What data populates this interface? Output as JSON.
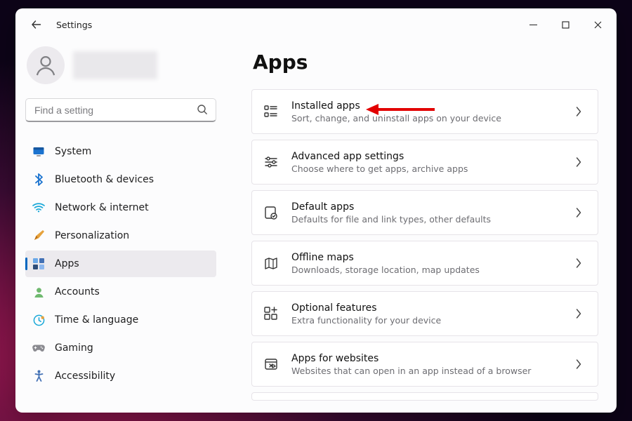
{
  "window": {
    "title": "Settings"
  },
  "search": {
    "placeholder": "Find a setting"
  },
  "nav": {
    "items": [
      {
        "label": "System"
      },
      {
        "label": "Bluetooth & devices"
      },
      {
        "label": "Network & internet"
      },
      {
        "label": "Personalization"
      },
      {
        "label": "Apps"
      },
      {
        "label": "Accounts"
      },
      {
        "label": "Time & language"
      },
      {
        "label": "Gaming"
      },
      {
        "label": "Accessibility"
      }
    ]
  },
  "page": {
    "title": "Apps",
    "cards": [
      {
        "title": "Installed apps",
        "sub": "Sort, change, and uninstall apps on your device"
      },
      {
        "title": "Advanced app settings",
        "sub": "Choose where to get apps, archive apps"
      },
      {
        "title": "Default apps",
        "sub": "Defaults for file and link types, other defaults"
      },
      {
        "title": "Offline maps",
        "sub": "Downloads, storage location, map updates"
      },
      {
        "title": "Optional features",
        "sub": "Extra functionality for your device"
      },
      {
        "title": "Apps for websites",
        "sub": "Websites that can open in an app instead of a browser"
      }
    ]
  },
  "colors": {
    "accent": "#0067c0",
    "subtext": "#6d6d72"
  }
}
